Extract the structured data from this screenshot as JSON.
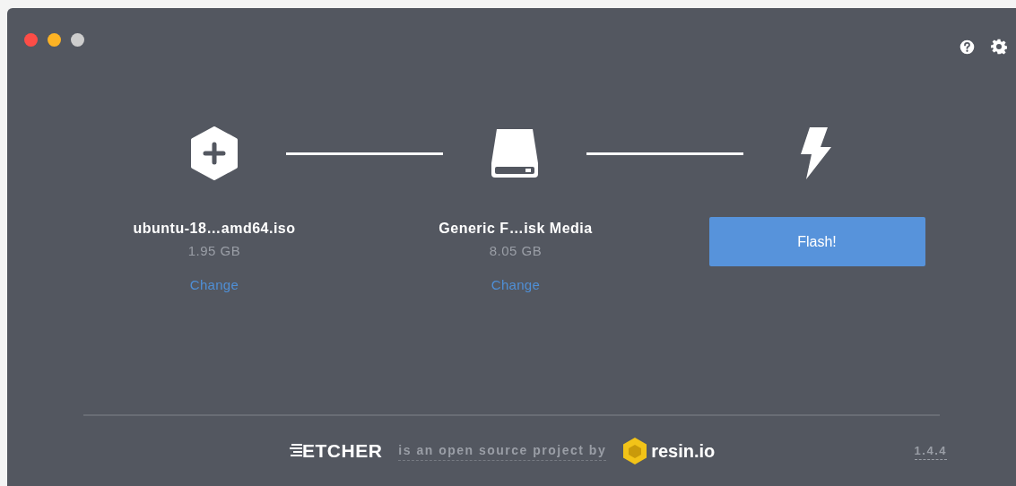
{
  "steps": [
    {
      "kind": "image",
      "title": "ubuntu-18…amd64.iso",
      "size": "1.95 GB",
      "action": "Change"
    },
    {
      "kind": "drive",
      "title": "Generic F…isk Media",
      "size": "8.05 GB",
      "action": "Change"
    },
    {
      "kind": "flash",
      "button": "Flash!"
    }
  ],
  "footer": {
    "logo": "ETCHER",
    "tagline": "is an open source project by",
    "company": "resin.io",
    "version": "1.4.4"
  }
}
